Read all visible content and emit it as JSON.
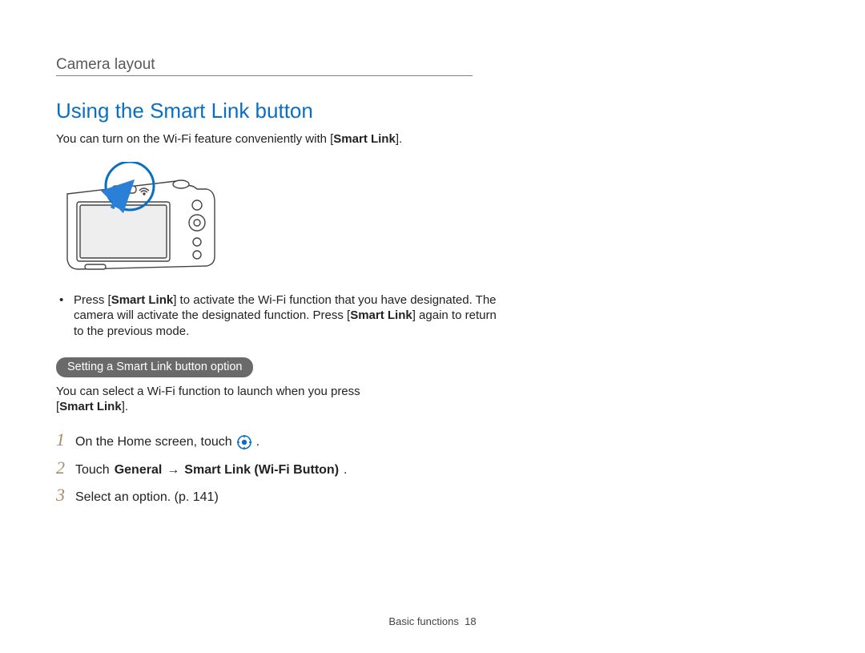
{
  "header": {
    "breadcrumb": "Camera layout"
  },
  "section": {
    "title": "Using the Smart Link button",
    "intro_pre": "You can turn on the Wi-Fi feature conveniently with [",
    "intro_bold": "Smart Link",
    "intro_post": "]."
  },
  "bullet": {
    "press1_pre": "Press [",
    "press1_bold": "Smart Link",
    "press1_post": "] to activate the Wi-Fi function that you have designated. The camera will activate the designated function. Press [",
    "press2_bold": "Smart Link",
    "press2_post": "] again to return to the previous mode."
  },
  "subheader": "Setting a Smart Link button option",
  "subintro": {
    "line1": "You can select a Wi-Fi function to launch when you press",
    "line2_pre": "[",
    "line2_bold": "Smart Link",
    "line2_post": "]."
  },
  "steps": [
    {
      "num": "1",
      "text_pre": "On the Home screen, touch ",
      "text_post": "."
    },
    {
      "num": "2",
      "text_pre": "Touch ",
      "bold1": "General",
      "arrow": " → ",
      "bold2": "Smart Link (Wi-Fi Button)",
      "text_post": "."
    },
    {
      "num": "3",
      "text_pre": "Select an option. (p. 141)"
    }
  ],
  "footer": {
    "section": "Basic functions",
    "page": "18"
  }
}
